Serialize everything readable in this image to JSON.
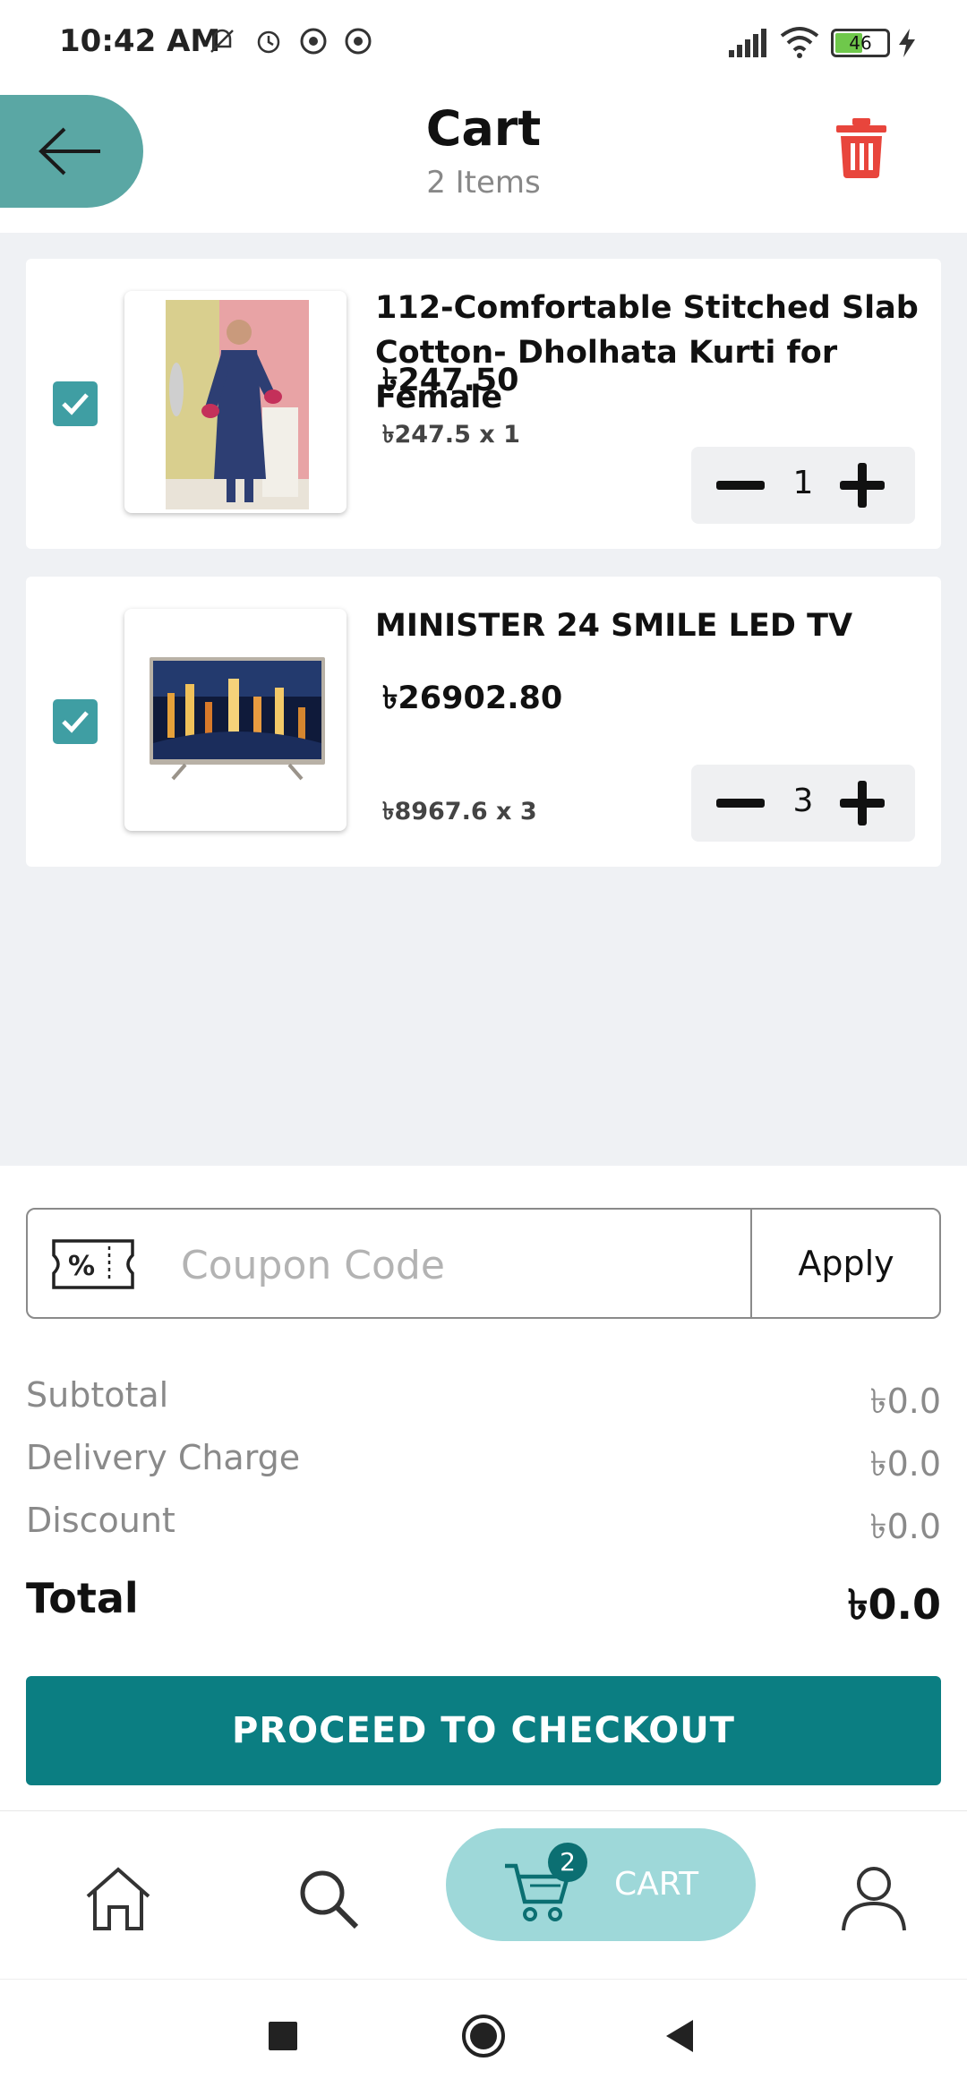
{
  "status_bar": {
    "time": "10:42 AM",
    "battery": "46"
  },
  "header": {
    "title": "Cart",
    "subtitle": "2 Items"
  },
  "items": [
    {
      "name": "112-Comfortable Stitched Slab Cotton- Dholhata Kurti for Female",
      "price": "৳247.50",
      "unit": "৳247.5 x 1",
      "qty": "1",
      "checked": true
    },
    {
      "name": "MINISTER 24 SMILE LED TV",
      "price": "৳26902.80",
      "unit": "৳8967.6 x 3",
      "qty": "3",
      "checked": true
    }
  ],
  "coupon": {
    "placeholder": "Coupon Code",
    "value": "",
    "apply_label": "Apply"
  },
  "summary": {
    "subtotal_label": "Subtotal",
    "subtotal_value": "৳0.0",
    "delivery_label": "Delivery Charge",
    "delivery_value": "৳0.0",
    "discount_label": "Discount",
    "discount_value": "৳0.0",
    "total_label": "Total",
    "total_value": "৳0.0"
  },
  "checkout_label": "PROCEED TO CHECKOUT",
  "bottom_nav": {
    "cart_label": "CART",
    "cart_badge": "2",
    "items": [
      "home-icon",
      "search-icon",
      "cart-icon",
      "user-icon"
    ]
  },
  "colors": {
    "accent": "#0b7e82",
    "back_button": "#5aa7a4",
    "checkbox": "#3f9ea3",
    "trash": "#e8453c",
    "cart_pill": "#9ed8d9"
  }
}
